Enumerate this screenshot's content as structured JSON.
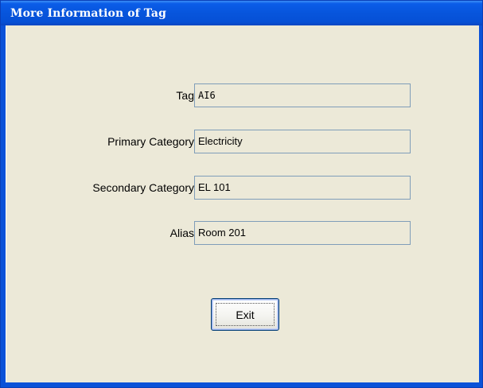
{
  "window": {
    "title": "More Information of Tag"
  },
  "form": {
    "fields": [
      {
        "label": "Tag",
        "value": "AI6"
      },
      {
        "label": "Primary Category",
        "value": "Electricity"
      },
      {
        "label": "Secondary Category",
        "value": "EL 101"
      },
      {
        "label": "Alias",
        "value": "Room 201"
      }
    ]
  },
  "actions": {
    "exit_label": "Exit"
  },
  "colors": {
    "titlebar": "#0755dc",
    "client_background": "#ece9d8",
    "field_border": "#7f9db9",
    "button_border": "#003c74"
  }
}
